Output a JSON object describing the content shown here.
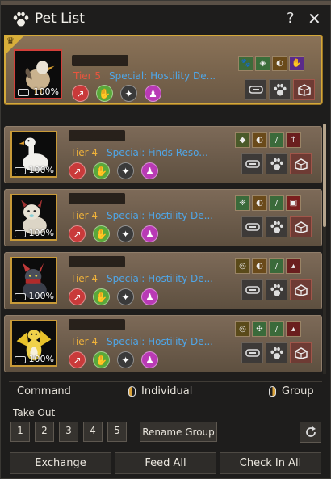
{
  "window": {
    "title": "Pet List",
    "help_glyph": "?",
    "close_glyph": "✕"
  },
  "pets": [
    {
      "tier": "Tier 5",
      "tier_color": "#e8553e",
      "special": "Special: Hostility De...",
      "hunger": "100%",
      "selected": true,
      "traits": [
        [
          "#3d6b3a",
          "🐾"
        ],
        [
          "#3a6e3a",
          "◈"
        ],
        [
          "#6a4a1a",
          "◐"
        ],
        [
          "#5a2a8a",
          "✋"
        ]
      ]
    },
    {
      "tier": "Tier 4",
      "tier_color": "#f0b23a",
      "special": "Special: Finds Reso...",
      "hunger": "100%",
      "selected": false,
      "traits": [
        [
          "#4a5a2a",
          "◆"
        ],
        [
          "#6a4a1a",
          "◐"
        ],
        [
          "#3a6a3a",
          "/"
        ],
        [
          "#6a1e1e",
          "↑"
        ]
      ]
    },
    {
      "tier": "Tier 4",
      "tier_color": "#f0b23a",
      "special": "Special: Hostility De...",
      "hunger": "100%",
      "selected": false,
      "traits": [
        [
          "#3a6a3a",
          "❈"
        ],
        [
          "#6a4a1a",
          "◐"
        ],
        [
          "#3a6a3a",
          "/"
        ],
        [
          "#7a1e1e",
          "▣"
        ]
      ]
    },
    {
      "tier": "Tier 4",
      "tier_color": "#f0b23a",
      "special": "Special: Hostility De...",
      "hunger": "100%",
      "selected": false,
      "traits": [
        [
          "#5a4a1a",
          "◎"
        ],
        [
          "#6a4a1a",
          "◐"
        ],
        [
          "#3a6a3a",
          "/"
        ],
        [
          "#6a1e1e",
          "▴"
        ]
      ]
    },
    {
      "tier": "Tier 4",
      "tier_color": "#f0b23a",
      "special": "Special: Hostility De...",
      "hunger": "100%",
      "selected": false,
      "traits": [
        [
          "#5a4a1a",
          "◎"
        ],
        [
          "#3a6a3a",
          "✣"
        ],
        [
          "#3a6a3a",
          "/"
        ],
        [
          "#6a1e1e",
          "▴"
        ]
      ]
    }
  ],
  "skills": [
    {
      "color": "#c93a3a",
      "glyph": "↗"
    },
    {
      "color": "#5aa83a",
      "glyph": "✋"
    },
    {
      "color": "#3a3a3a",
      "glyph": "✦"
    },
    {
      "color": "#b93ab5",
      "glyph": "♟"
    }
  ],
  "command": {
    "label": "Command",
    "individual": "Individual",
    "group": "Group"
  },
  "take_out": {
    "label": "Take Out",
    "groups": [
      "1",
      "2",
      "3",
      "4",
      "5"
    ],
    "rename_label": "Rename Group"
  },
  "bottom": {
    "exchange": "Exchange",
    "feed_all": "Feed All",
    "check_in_all": "Check In All"
  },
  "colors": {
    "accent_gold": "#d4a93a",
    "special_blue": "#4fa6e8"
  }
}
